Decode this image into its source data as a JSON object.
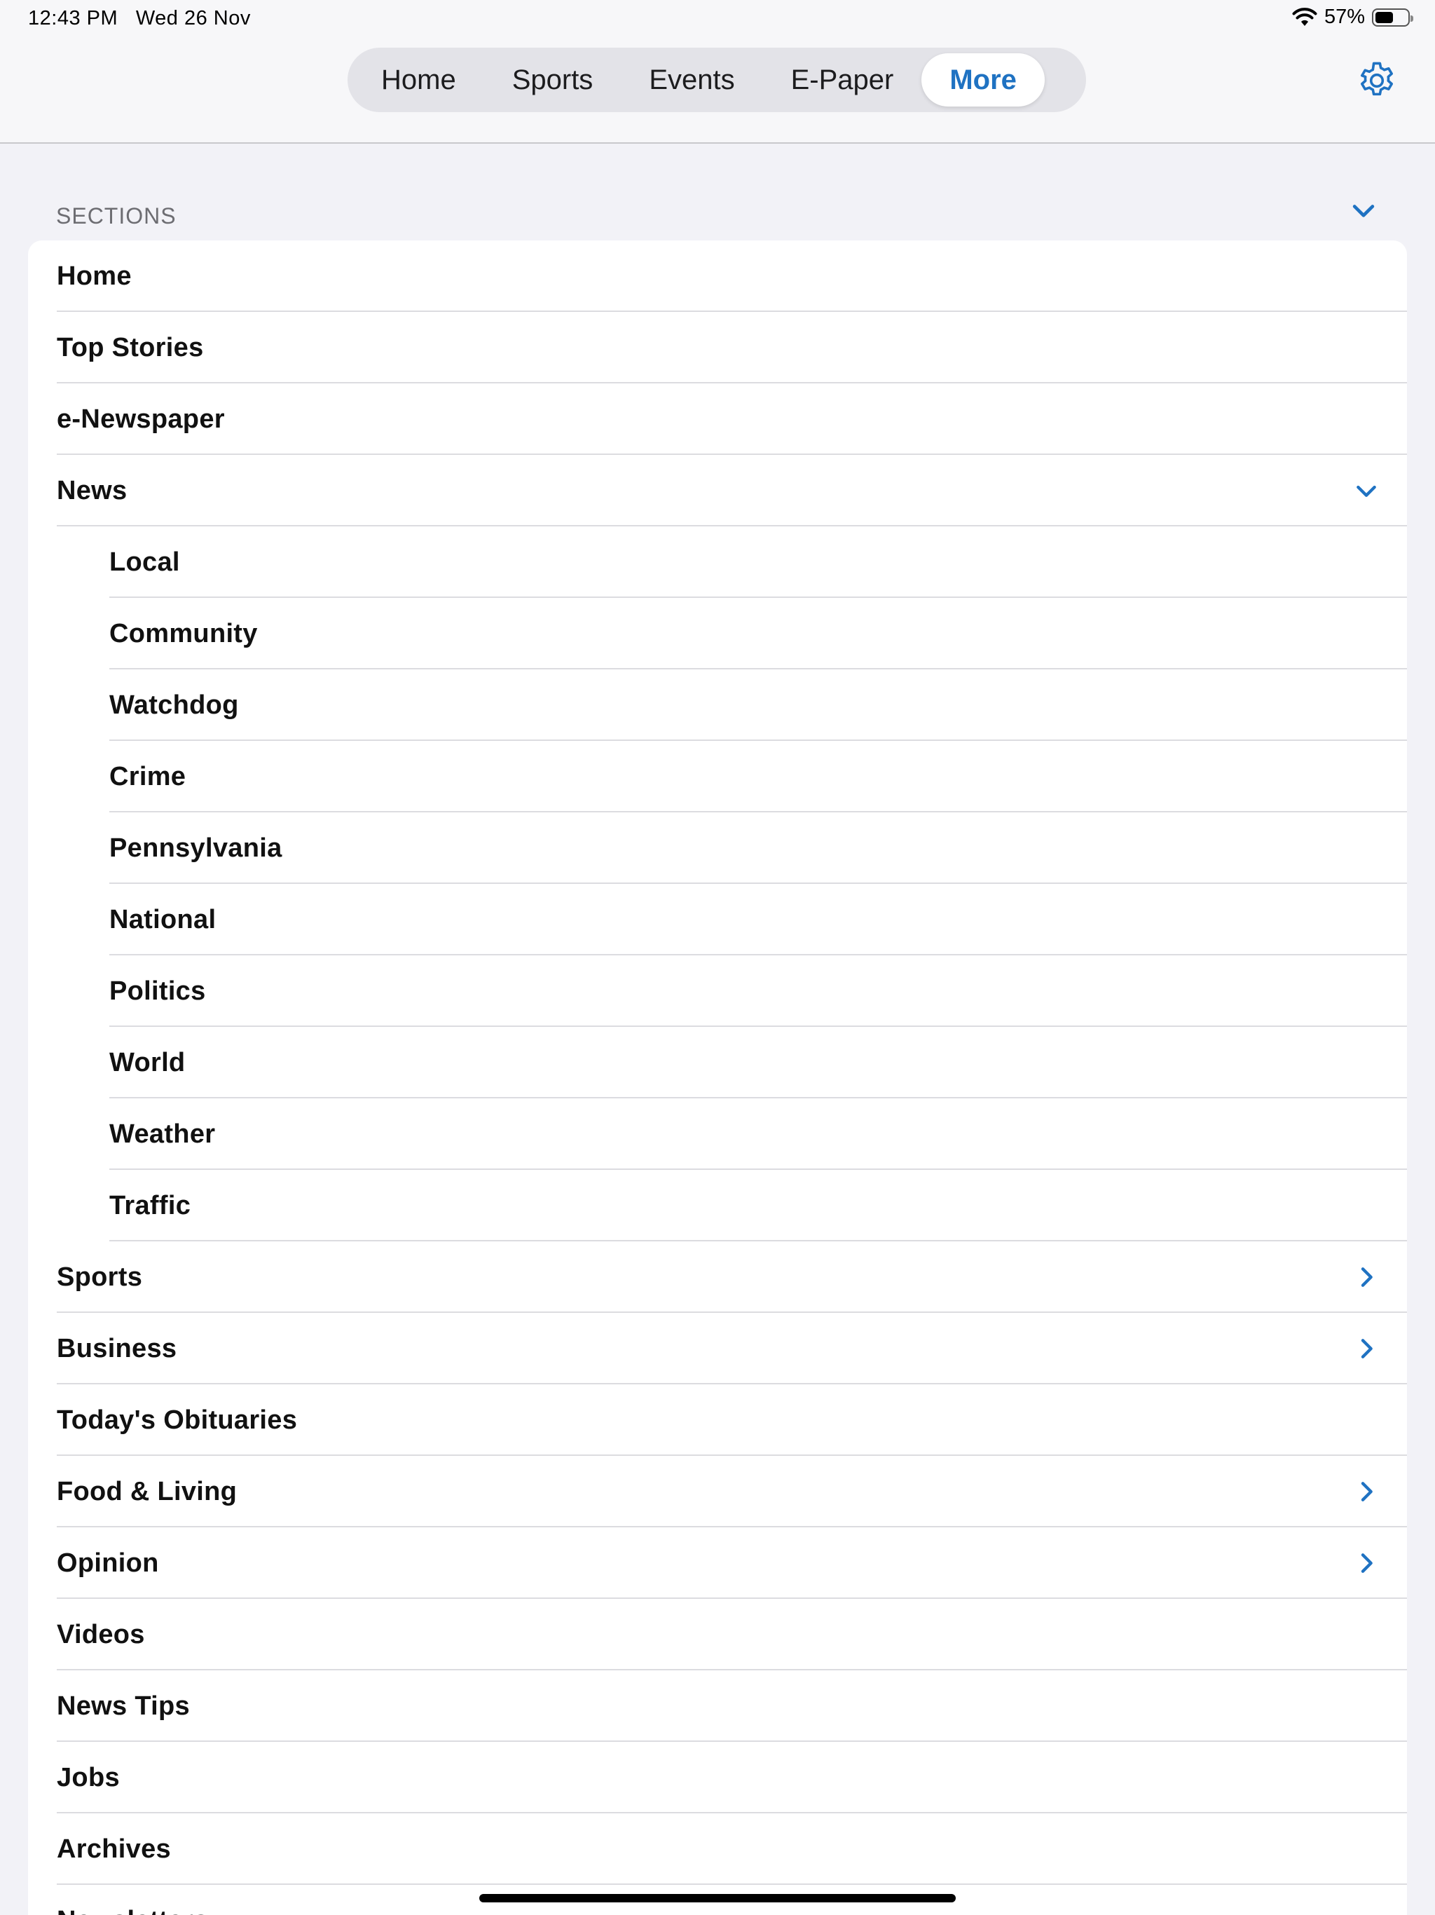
{
  "status_bar": {
    "time": "12:43 PM",
    "date": "Wed 26 Nov",
    "battery": "57%",
    "battery_level": 0.57
  },
  "nav": {
    "tabs": [
      {
        "label": "Home",
        "active": false
      },
      {
        "label": "Sports",
        "active": false
      },
      {
        "label": "Events",
        "active": false
      },
      {
        "label": "E-Paper",
        "active": false
      },
      {
        "label": "More",
        "active": true
      }
    ],
    "settings_icon": "gear-icon"
  },
  "sections": {
    "header": "SECTIONS",
    "items": [
      {
        "label": "Home",
        "level": 0,
        "chevron": "none"
      },
      {
        "label": "Top Stories",
        "level": 0,
        "chevron": "none"
      },
      {
        "label": "e-Newspaper",
        "level": 0,
        "chevron": "none"
      },
      {
        "label": "News",
        "level": 0,
        "chevron": "down"
      },
      {
        "label": "Local",
        "level": 1,
        "chevron": "none"
      },
      {
        "label": "Community",
        "level": 1,
        "chevron": "none"
      },
      {
        "label": "Watchdog",
        "level": 1,
        "chevron": "none"
      },
      {
        "label": "Crime",
        "level": 1,
        "chevron": "none"
      },
      {
        "label": "Pennsylvania",
        "level": 1,
        "chevron": "none"
      },
      {
        "label": "National",
        "level": 1,
        "chevron": "none"
      },
      {
        "label": "Politics",
        "level": 1,
        "chevron": "none"
      },
      {
        "label": "World",
        "level": 1,
        "chevron": "none"
      },
      {
        "label": "Weather",
        "level": 1,
        "chevron": "none"
      },
      {
        "label": "Traffic",
        "level": 1,
        "chevron": "none"
      },
      {
        "label": "Sports",
        "level": 0,
        "chevron": "right"
      },
      {
        "label": "Business",
        "level": 0,
        "chevron": "right"
      },
      {
        "label": "Today's Obituaries",
        "level": 0,
        "chevron": "none"
      },
      {
        "label": "Food & Living",
        "level": 0,
        "chevron": "right"
      },
      {
        "label": "Opinion",
        "level": 0,
        "chevron": "right"
      },
      {
        "label": "Videos",
        "level": 0,
        "chevron": "none"
      },
      {
        "label": "News Tips",
        "level": 0,
        "chevron": "none"
      },
      {
        "label": "Jobs",
        "level": 0,
        "chevron": "none"
      },
      {
        "label": "Archives",
        "level": 0,
        "chevron": "none"
      },
      {
        "label": "Newsletters",
        "level": 0,
        "chevron": "none"
      }
    ]
  },
  "colors": {
    "accent": "#1f72c2",
    "background": "#f2f2f7",
    "card": "#ffffff",
    "separator": "#dcdce0"
  }
}
